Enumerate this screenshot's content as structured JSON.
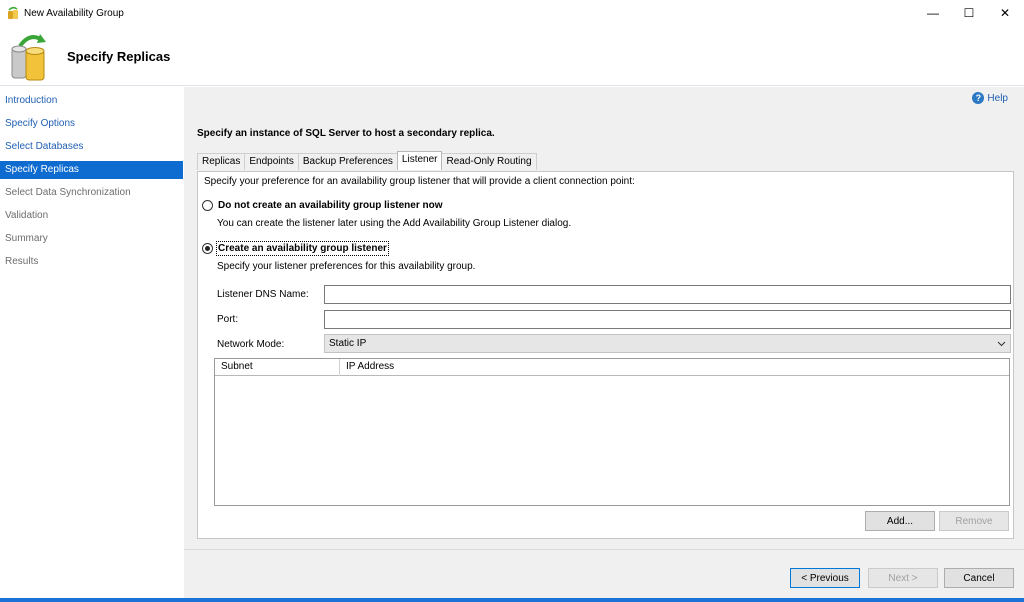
{
  "window": {
    "title": "New Availability Group",
    "controls": {
      "minimize": "—",
      "maximize": "☐",
      "close": "✕"
    }
  },
  "header": {
    "title": "Specify Replicas"
  },
  "sidebar": {
    "items": [
      {
        "label": "Introduction",
        "state": "link"
      },
      {
        "label": "Specify Options",
        "state": "link"
      },
      {
        "label": "Select Databases",
        "state": "link"
      },
      {
        "label": "Specify Replicas",
        "state": "active"
      },
      {
        "label": "Select Data Synchronization",
        "state": "inactive"
      },
      {
        "label": "Validation",
        "state": "inactive"
      },
      {
        "label": "Summary",
        "state": "inactive"
      },
      {
        "label": "Results",
        "state": "inactive"
      }
    ]
  },
  "help": {
    "label": "Help",
    "icon": "?"
  },
  "main": {
    "instruction": "Specify an instance of SQL Server to host a secondary replica.",
    "tabs": [
      {
        "label": "Replicas",
        "active": false
      },
      {
        "label": "Endpoints",
        "active": false
      },
      {
        "label": "Backup Preferences",
        "active": false
      },
      {
        "label": "Listener",
        "active": true
      },
      {
        "label": "Read-Only Routing",
        "active": false
      }
    ]
  },
  "listener": {
    "intro": "Specify your preference for an availability group listener that will provide a client connection point:",
    "option_none": {
      "label": "Do not create an availability group listener now",
      "description": "You can create the listener later using the Add Availability Group Listener dialog.",
      "checked": false
    },
    "option_create": {
      "label": "Create an availability group listener",
      "description": "Specify your listener preferences for this availability group.",
      "checked": true
    },
    "dns_label": "Listener DNS Name:",
    "dns_value": "",
    "port_label": "Port:",
    "port_value": "",
    "network_mode_label": "Network Mode:",
    "network_mode_value": "Static IP",
    "grid_columns": [
      "Subnet",
      "IP Address"
    ],
    "add_button": "Add...",
    "remove_button": "Remove"
  },
  "footer": {
    "previous": "< Previous",
    "next": "Next >",
    "cancel": "Cancel"
  },
  "colors": {
    "accent": "#0e6bd0",
    "link": "#1f5fb3",
    "panel_bg": "#f0f0f0"
  }
}
